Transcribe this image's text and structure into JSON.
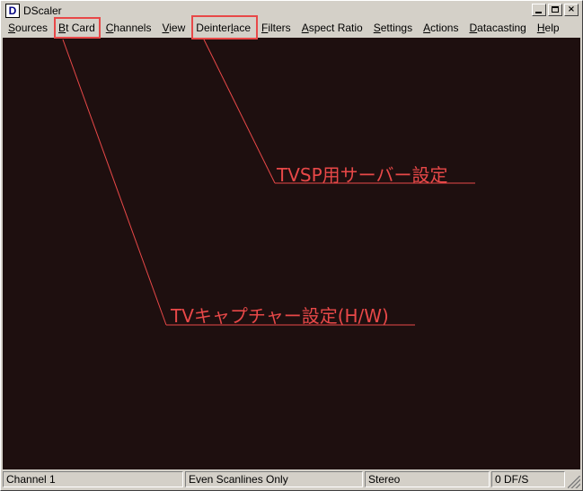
{
  "window": {
    "title": "DScaler",
    "icon_letter": "D",
    "buttons": [
      "minimize",
      "maximize",
      "close"
    ],
    "close_glyph": "×"
  },
  "menu": [
    {
      "label": "Sources",
      "key": "S"
    },
    {
      "label": "Bt Card",
      "key": "B"
    },
    {
      "label": "Channels",
      "key": "C"
    },
    {
      "label": "View",
      "key": "V"
    },
    {
      "label": "Deinterlace",
      "key": "l"
    },
    {
      "label": "Filters",
      "key": "F"
    },
    {
      "label": "Aspect Ratio",
      "key": "A"
    },
    {
      "label": "Settings",
      "key": "S"
    },
    {
      "label": "Actions",
      "key": "A"
    },
    {
      "label": "Datacasting",
      "key": "D"
    },
    {
      "label": "Help",
      "key": "H"
    }
  ],
  "status": {
    "channel": "Channel 1",
    "deinterlace_mode": "Even Scanlines Only",
    "audio": "Stereo",
    "dropped_frames": "0 DF/S"
  },
  "annotations": {
    "server_setting": "TVSP用サーバー設定",
    "capture_setting": "TVキャプチャー設定(H/W)",
    "color": "#e84848"
  },
  "colors": {
    "video_background": "#1e0f0f",
    "chrome": "#d4d0c8"
  }
}
